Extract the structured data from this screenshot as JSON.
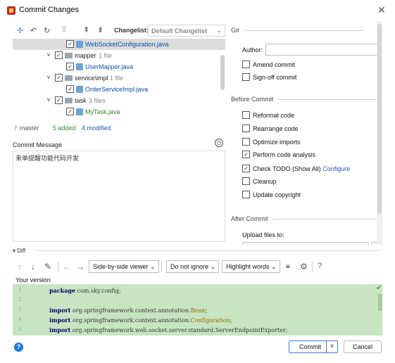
{
  "window": {
    "title": "Commit Changes",
    "close_glyph": "✕"
  },
  "toolbar": {
    "changelist_label": "Changelist:",
    "changelist_value": "Default Changelist"
  },
  "tree": {
    "rows": [
      {
        "name": "WebSocketConfiguration.java",
        "type": "file",
        "selected": true
      },
      {
        "name": "mapper",
        "count": "1 file",
        "type": "folder"
      },
      {
        "name": "UserMapper.java",
        "type": "file"
      },
      {
        "name": "service\\impl",
        "count": "1 file",
        "type": "folder"
      },
      {
        "name": "OrderServiceImpl.java",
        "type": "file"
      },
      {
        "name": "task",
        "count": "3 files",
        "type": "folder"
      },
      {
        "name": "MyTask.java",
        "type": "file"
      }
    ]
  },
  "status": {
    "branch": "master",
    "added": "5 added",
    "modified": "4 modified"
  },
  "commit_message": {
    "label": "Commit Message",
    "text": "来单提醒功能代码开发"
  },
  "git": {
    "section_title": "Git",
    "author_label": "Author:",
    "author_value": "",
    "amend": "Amend commit",
    "signoff": "Sign-off commit"
  },
  "before_commit": {
    "section_title": "Before Commit",
    "items": [
      {
        "label": "Reformat code",
        "checked": false
      },
      {
        "label": "Rearrange code",
        "checked": false
      },
      {
        "label": "Optimize imports",
        "checked": false
      },
      {
        "label": "Perform code analysis",
        "checked": true
      },
      {
        "label": "Check TODO (Show All)",
        "checked": true,
        "link": "Configure"
      },
      {
        "label": "Cleanup",
        "checked": false
      },
      {
        "label": "Update copyright",
        "checked": false
      }
    ]
  },
  "after_commit": {
    "section_title": "After Commit",
    "upload_label": "Upload files to:"
  },
  "diff": {
    "header": "Diff",
    "viewer": "Side-by-side viewer",
    "ignore": "Do not ignore",
    "highlight": "Highlight words",
    "help": "?",
    "version_label": "Your version",
    "lines": [
      {
        "num": "1",
        "kw": "package",
        "rest": " com.sky.config;"
      },
      {
        "num": "2",
        "kw": "",
        "rest": ""
      },
      {
        "num": "3",
        "kw": "import",
        "rest": " org.springframework.context.annotation.",
        "cls": "Bean",
        "tail": ";"
      },
      {
        "num": "4",
        "kw": "import",
        "rest": " org.springframework.context.annotation.",
        "cls": "Configuration",
        "tail": ";"
      },
      {
        "num": "5",
        "kw": "import",
        "rest": " org.springframework.web.socket.server.standard.ServerEndpointExporter;",
        "cls": "",
        "tail": ""
      }
    ]
  },
  "footer": {
    "help": "?",
    "commit": "Commit",
    "cancel": "Cancel"
  }
}
